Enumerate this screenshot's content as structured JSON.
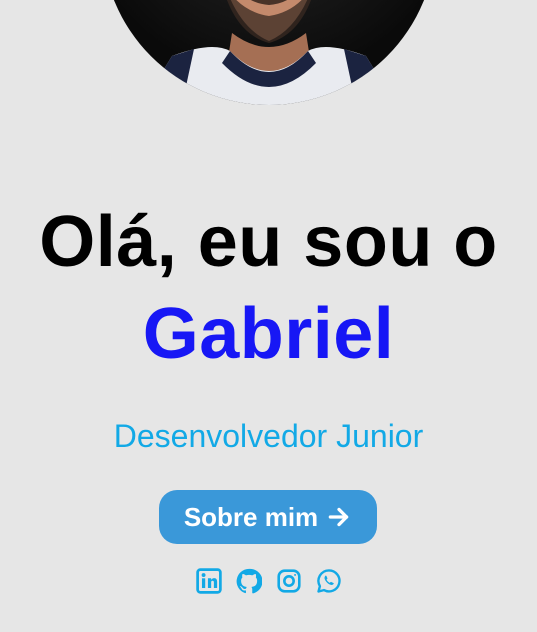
{
  "hero": {
    "greeting": "Olá, eu sou o",
    "name": "Gabriel",
    "role": "Desenvolvedor Junior"
  },
  "cta": {
    "label": "Sobre mim",
    "icon": "arrow-right-icon"
  },
  "socials": [
    {
      "icon": "linkedin-icon"
    },
    {
      "icon": "github-icon"
    },
    {
      "icon": "instagram-icon"
    },
    {
      "icon": "whatsapp-icon"
    }
  ],
  "colors": {
    "background": "#e6e6e6",
    "heading": "#000000",
    "name": "#1717f5",
    "role": "#12a9e6",
    "button": "#3a98d9",
    "button_text": "#ffffff",
    "social_icons": "#12a9e6"
  }
}
